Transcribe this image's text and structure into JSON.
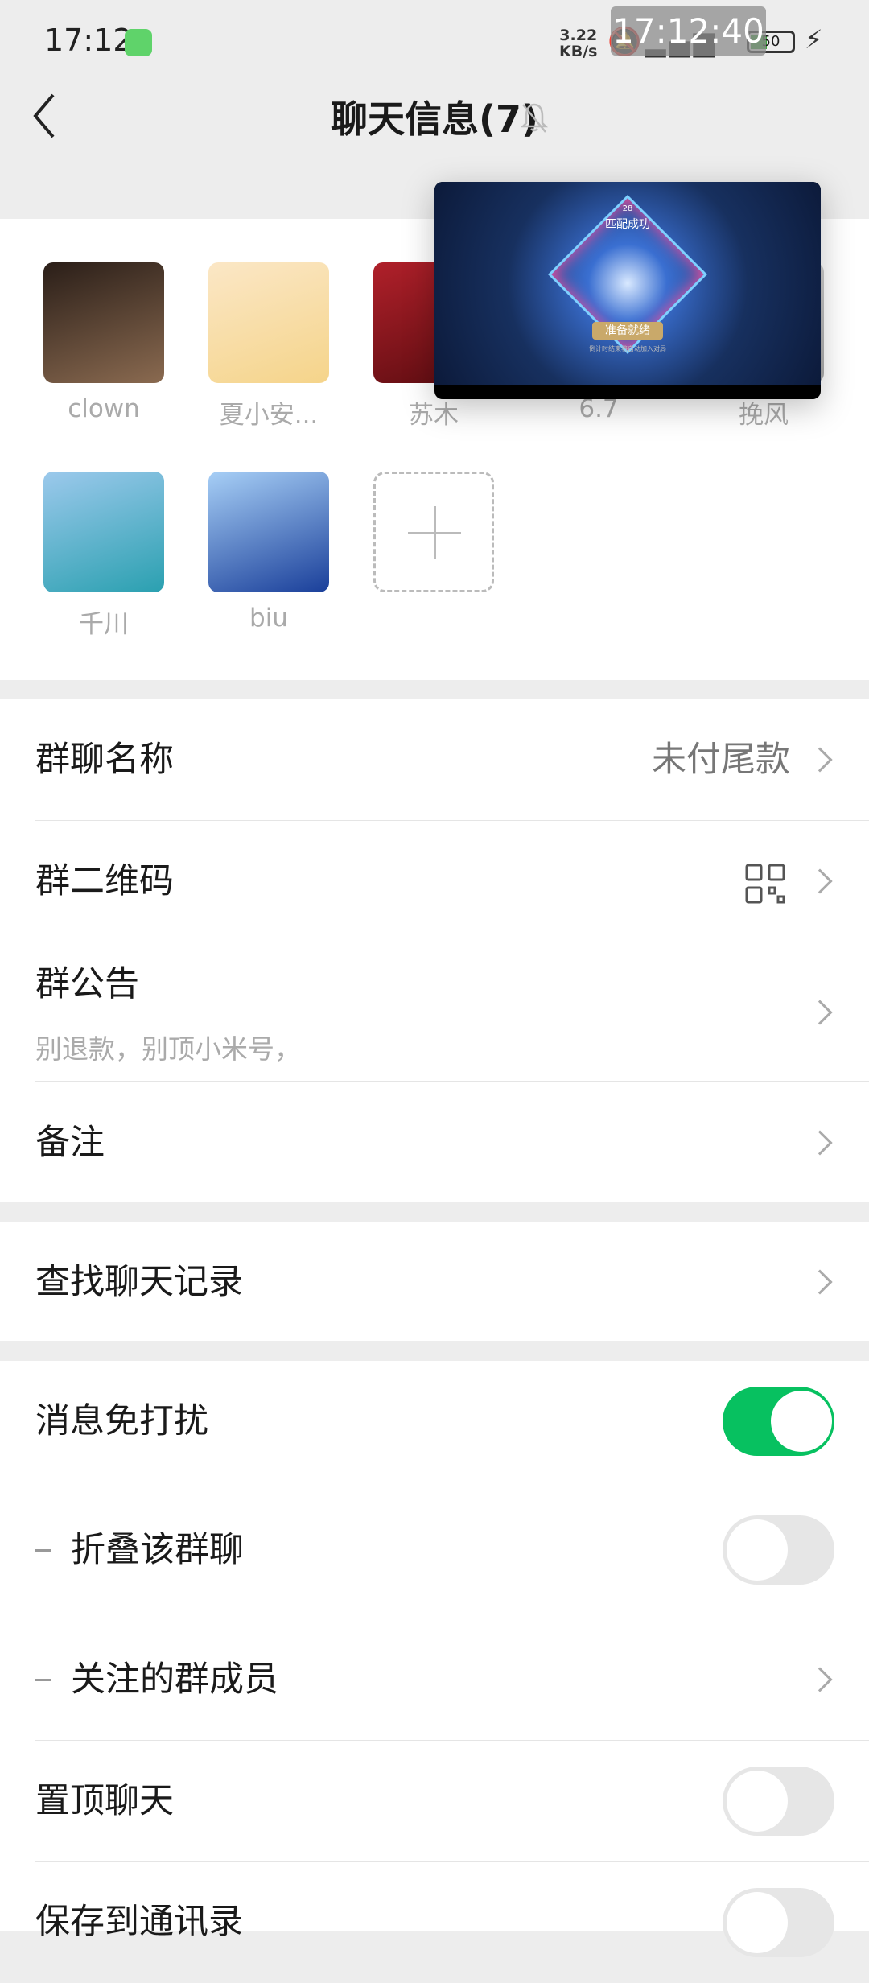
{
  "status_bar": {
    "time": "17:12",
    "net_speed_value": "3.22",
    "net_speed_unit": "KB/s",
    "battery": "50",
    "screen_clock": "17:12:40",
    "icons": [
      "battery-app-icon",
      "bell-off-icon",
      "hd-signal-icon",
      "wifi-icon",
      "battery-icon",
      "charging-icon"
    ]
  },
  "nav": {
    "title": "聊天信息(7)",
    "back_icon": "chevron-left-icon",
    "mute_icon": "bell-off-icon"
  },
  "members": [
    {
      "name": "clown",
      "colors": [
        "#2a1e18",
        "#8a6a50"
      ]
    },
    {
      "name": "夏小安...",
      "colors": [
        "#fbe7c6",
        "#f5d48a"
      ]
    },
    {
      "name": "苏木",
      "colors": [
        "#b0202a",
        "#5a0c10"
      ]
    },
    {
      "name": "6.7",
      "colors": [
        "#ccc",
        "#999"
      ]
    },
    {
      "name": "挽风",
      "colors": [
        "#ddd",
        "#aaa"
      ]
    },
    {
      "name": "千川",
      "colors": [
        "#9cc9ec",
        "#2aa0b0"
      ]
    },
    {
      "name": "biu",
      "colors": [
        "#a7cff6",
        "#1a3f9a"
      ]
    }
  ],
  "overlay": {
    "count": "28",
    "match_text": "匹配成功",
    "ready_button": "准备就绪",
    "hint": "倒计时结束将自动加入对局"
  },
  "settings": {
    "group_name": {
      "label": "群聊名称",
      "value": "未付尾款"
    },
    "qr_code": {
      "label": "群二维码"
    },
    "notice": {
      "label": "群公告",
      "value": "别退款，别顶小米号，"
    },
    "remark": {
      "label": "备注"
    },
    "search_history": {
      "label": "查找聊天记录"
    },
    "mute": {
      "label": "消息免打扰",
      "on": true
    },
    "fold": {
      "label": "折叠该群聊",
      "on": false
    },
    "watched_members": {
      "label": "关注的群成员"
    },
    "pin": {
      "label": "置顶聊天",
      "on": false
    },
    "save_contacts": {
      "label": "保存到通讯录",
      "on": false
    }
  },
  "colors": {
    "accent": "#07c160"
  }
}
